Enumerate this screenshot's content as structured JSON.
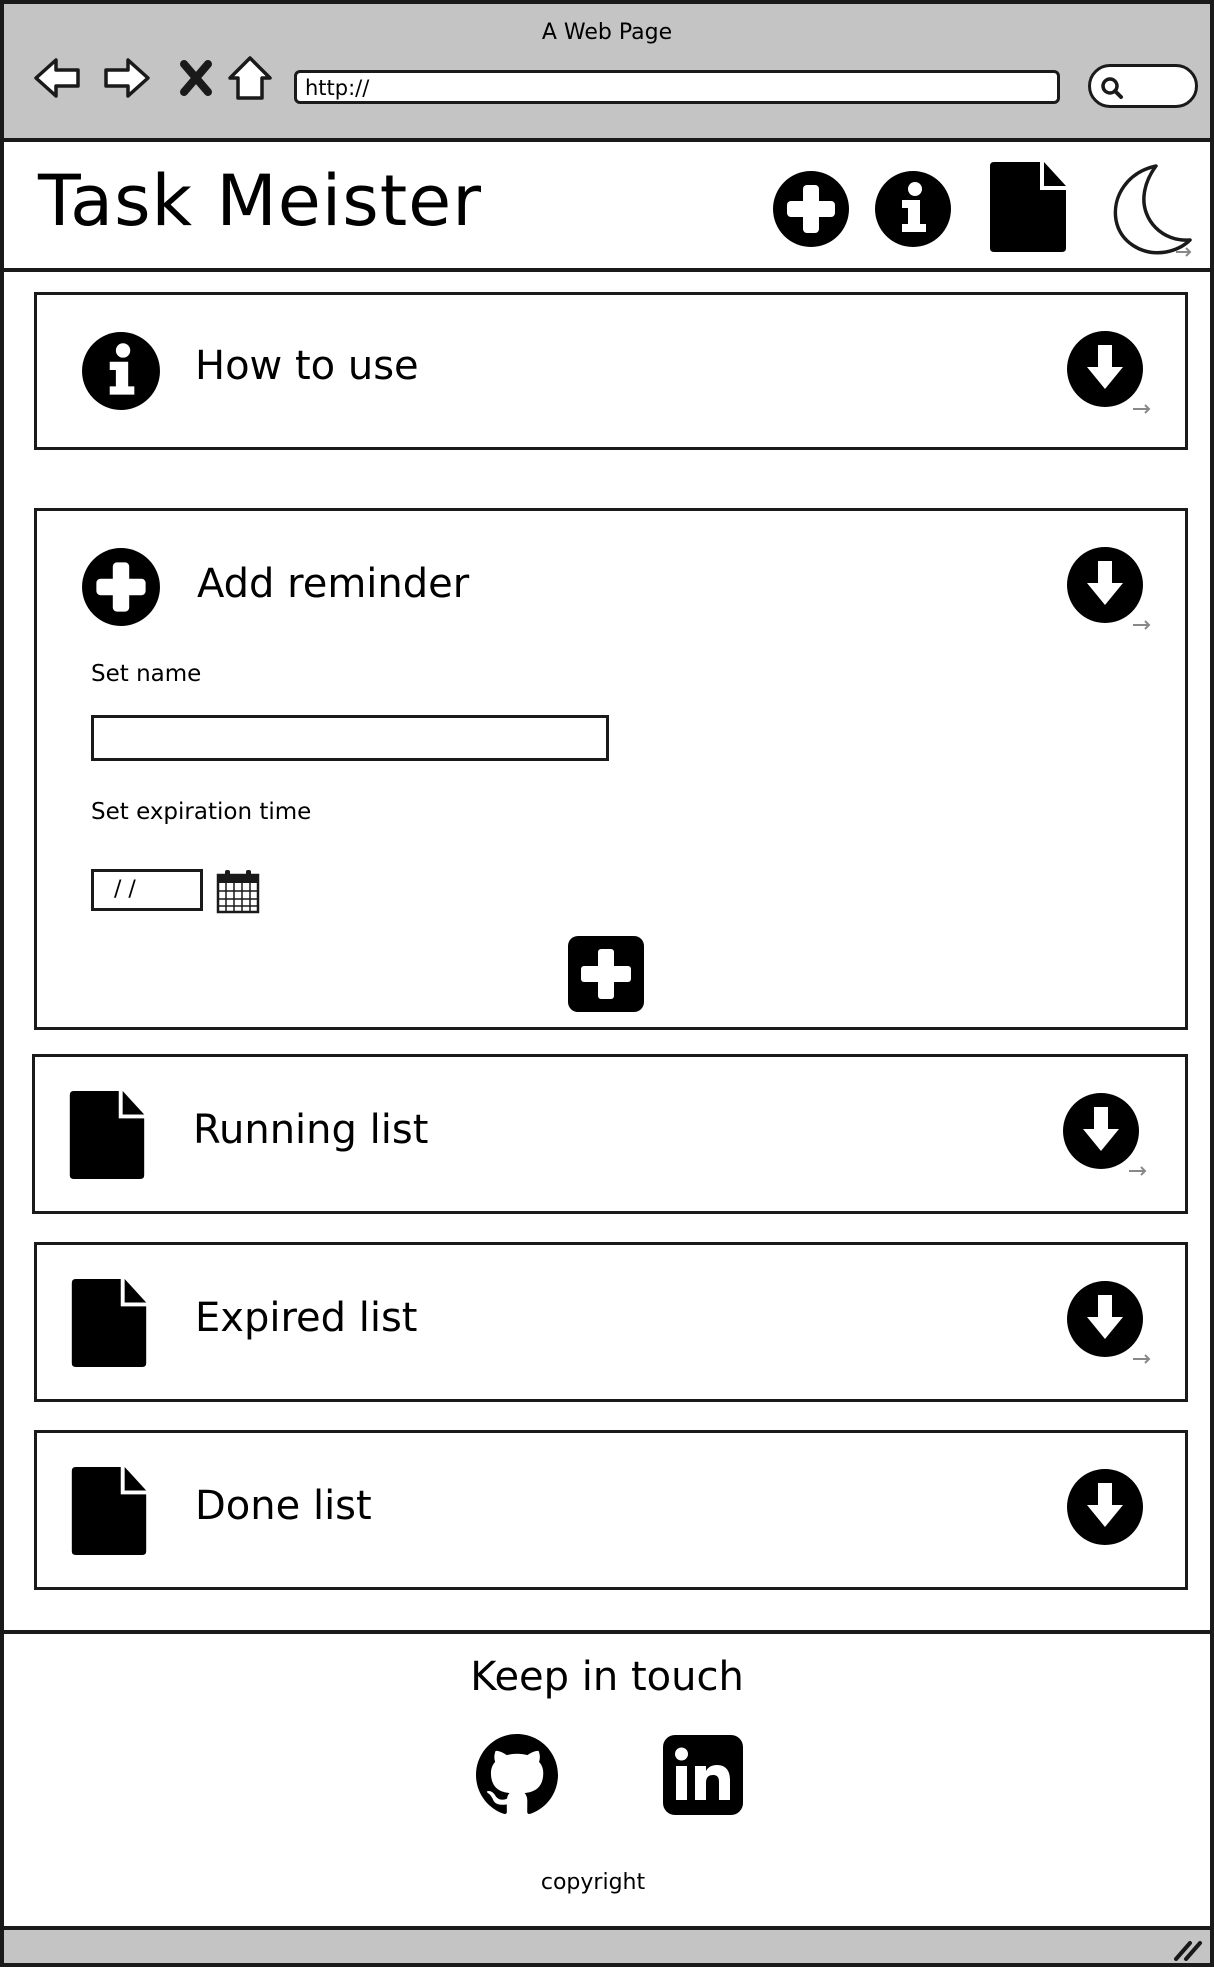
{
  "browser": {
    "window_title": "A Web Page",
    "url": "http://",
    "icons": [
      "back-arrow-icon",
      "forward-arrow-icon",
      "close-x-icon",
      "home-icon",
      "search-icon"
    ]
  },
  "header": {
    "title": "Task Meister",
    "icons": [
      "add-circle-icon",
      "info-circle-icon",
      "document-icon",
      "moon-icon"
    ]
  },
  "sections": [
    {
      "label": "How to use",
      "icon": "info-circle-icon"
    },
    {
      "label": "Add reminder",
      "icon": "add-circle-icon"
    },
    {
      "label": "Running list",
      "icon": "document-icon"
    },
    {
      "label": "Expired list",
      "icon": "document-icon"
    },
    {
      "label": "Done list",
      "icon": "document-icon"
    }
  ],
  "add_reminder": {
    "name_label": "Set name",
    "name_value": "",
    "expiration_label": "Set expiration time",
    "date_value": "/ /"
  },
  "footer": {
    "title": "Keep in touch",
    "social": [
      "github-icon",
      "linkedin-icon"
    ],
    "copyright": "copyright"
  }
}
